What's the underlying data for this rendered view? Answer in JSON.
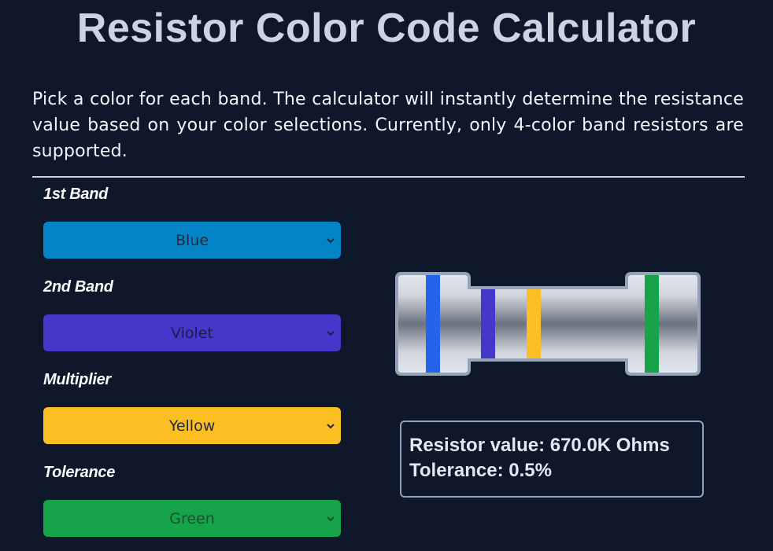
{
  "header": {
    "title": "Resistor Color Code Calculator",
    "description": "Pick a color for each band. The calculator will instantly determine the resistance value based on your color selections. Currently, only 4-color band resistors are supported."
  },
  "bands": [
    {
      "label": "1st Band",
      "selected": "Blue",
      "bg": "#0284c7",
      "fg": "#1e293b",
      "stripe": "#2563eb"
    },
    {
      "label": "2nd Band",
      "selected": "Violet",
      "bg": "#4338ca",
      "fg": "#1e1b4b",
      "stripe": "#4338ca"
    },
    {
      "label": "Multiplier",
      "selected": "Yellow",
      "bg": "#fbbf24",
      "fg": "#1e293b",
      "stripe": "#fbbf24"
    },
    {
      "label": "Tolerance",
      "selected": "Green",
      "bg": "#16a34a",
      "fg": "#14532d",
      "stripe": "#16a34a"
    }
  ],
  "result": {
    "value_text": "Resistor value: 670.0K Ohms",
    "tolerance_text": "Tolerance: 0.5%"
  },
  "colors": {
    "background": "#0f172a",
    "resistor_outline": "#94a3b8",
    "resistor_body_light": "#e2e8f0",
    "resistor_body_dark": "#6b7280"
  },
  "icons": {
    "select_arrow": "chevron-down-icon"
  }
}
